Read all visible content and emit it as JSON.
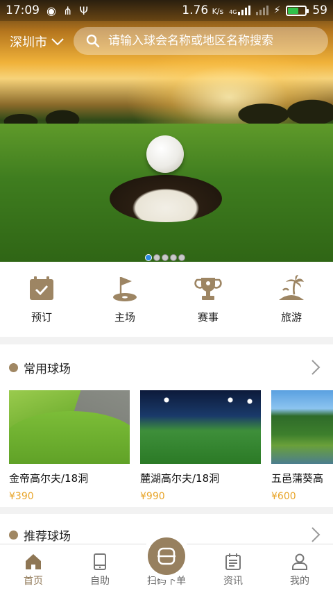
{
  "status_bar": {
    "time": "17:09",
    "network_speed": "1.76",
    "network_unit": "K/s",
    "network_type": "4G",
    "battery": "59",
    "battery_level": 0.59
  },
  "header": {
    "city": "深圳市",
    "search_placeholder": "请输入球会名称或地区名称搜索"
  },
  "banner": {
    "page_count": 5,
    "active_index": 0
  },
  "quick_entries": [
    {
      "label": "预订",
      "icon": "calendar-check-icon"
    },
    {
      "label": "主场",
      "icon": "golf-flag-icon"
    },
    {
      "label": "赛事",
      "icon": "trophy-icon"
    },
    {
      "label": "旅游",
      "icon": "palm-island-icon"
    }
  ],
  "sections": {
    "common": {
      "title": "常用球场",
      "courses": [
        {
          "name": "金帝高尔夫/18洞",
          "price": "¥390"
        },
        {
          "name": "麓湖高尔夫/18洞",
          "price": "¥990"
        },
        {
          "name": "五邑蒲葵高",
          "price": "¥600"
        }
      ]
    },
    "recommended": {
      "title": "推荐球场"
    }
  },
  "bottom_nav": [
    {
      "label": "首页",
      "icon": "home-icon",
      "active": true
    },
    {
      "label": "自助",
      "icon": "tablet-icon",
      "active": false
    },
    {
      "label": "扫码下单",
      "icon": "scan-icon",
      "active": false
    },
    {
      "label": "资讯",
      "icon": "news-icon",
      "active": false
    },
    {
      "label": "我的",
      "icon": "user-icon",
      "active": false
    }
  ],
  "colors": {
    "accent": "#97805f",
    "active_nav": "#8e7654",
    "price": "#e8a52a",
    "dot_active": "#2b8ae3"
  }
}
